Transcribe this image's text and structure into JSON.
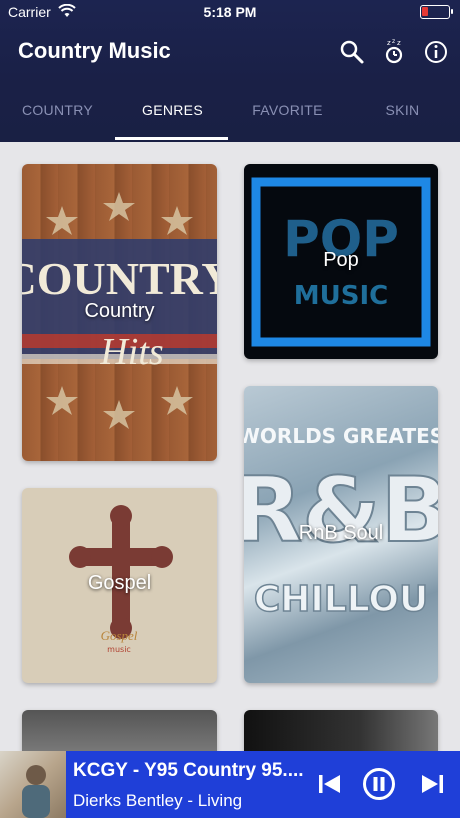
{
  "status": {
    "carrier": "Carrier",
    "time": "5:18 PM",
    "battery_level": 0.2,
    "battery_color": "#e53935"
  },
  "header": {
    "title": "Country Music",
    "icons": [
      "search-icon",
      "alarm-clock-icon",
      "info-icon"
    ],
    "background": "#1c2450"
  },
  "tabs": [
    {
      "label": "COUNTRY",
      "active": false
    },
    {
      "label": "GENRES",
      "active": true
    },
    {
      "label": "FAVORITE",
      "active": false
    },
    {
      "label": "SKIN",
      "active": false
    }
  ],
  "genres": [
    {
      "label": "Country",
      "art_text_1": "COUNTRY",
      "art_text_2": "Hits"
    },
    {
      "label": "Pop",
      "art_text_1": "POP",
      "art_text_2": "MUSIC"
    },
    {
      "label": "RnB Soul",
      "art_text_1": "WORLDS GREATES",
      "art_text_2": "R&B",
      "art_text_3": "CHILLOU"
    },
    {
      "label": "Gospel",
      "art_text_1": "Gospel",
      "art_text_2": "music"
    }
  ],
  "player": {
    "title": "KCGY - Y95 Country 95....",
    "subtitle": "Dierks Bentley - Living",
    "accent": "#1f3fd8",
    "controls": [
      "previous-icon",
      "pause-icon",
      "next-icon"
    ]
  }
}
